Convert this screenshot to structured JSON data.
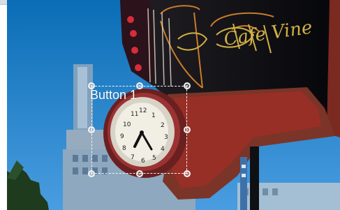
{
  "editor": {
    "selected_button_label": "Button 1"
  },
  "scene": {
    "sign_text": "Cafe Vine"
  }
}
